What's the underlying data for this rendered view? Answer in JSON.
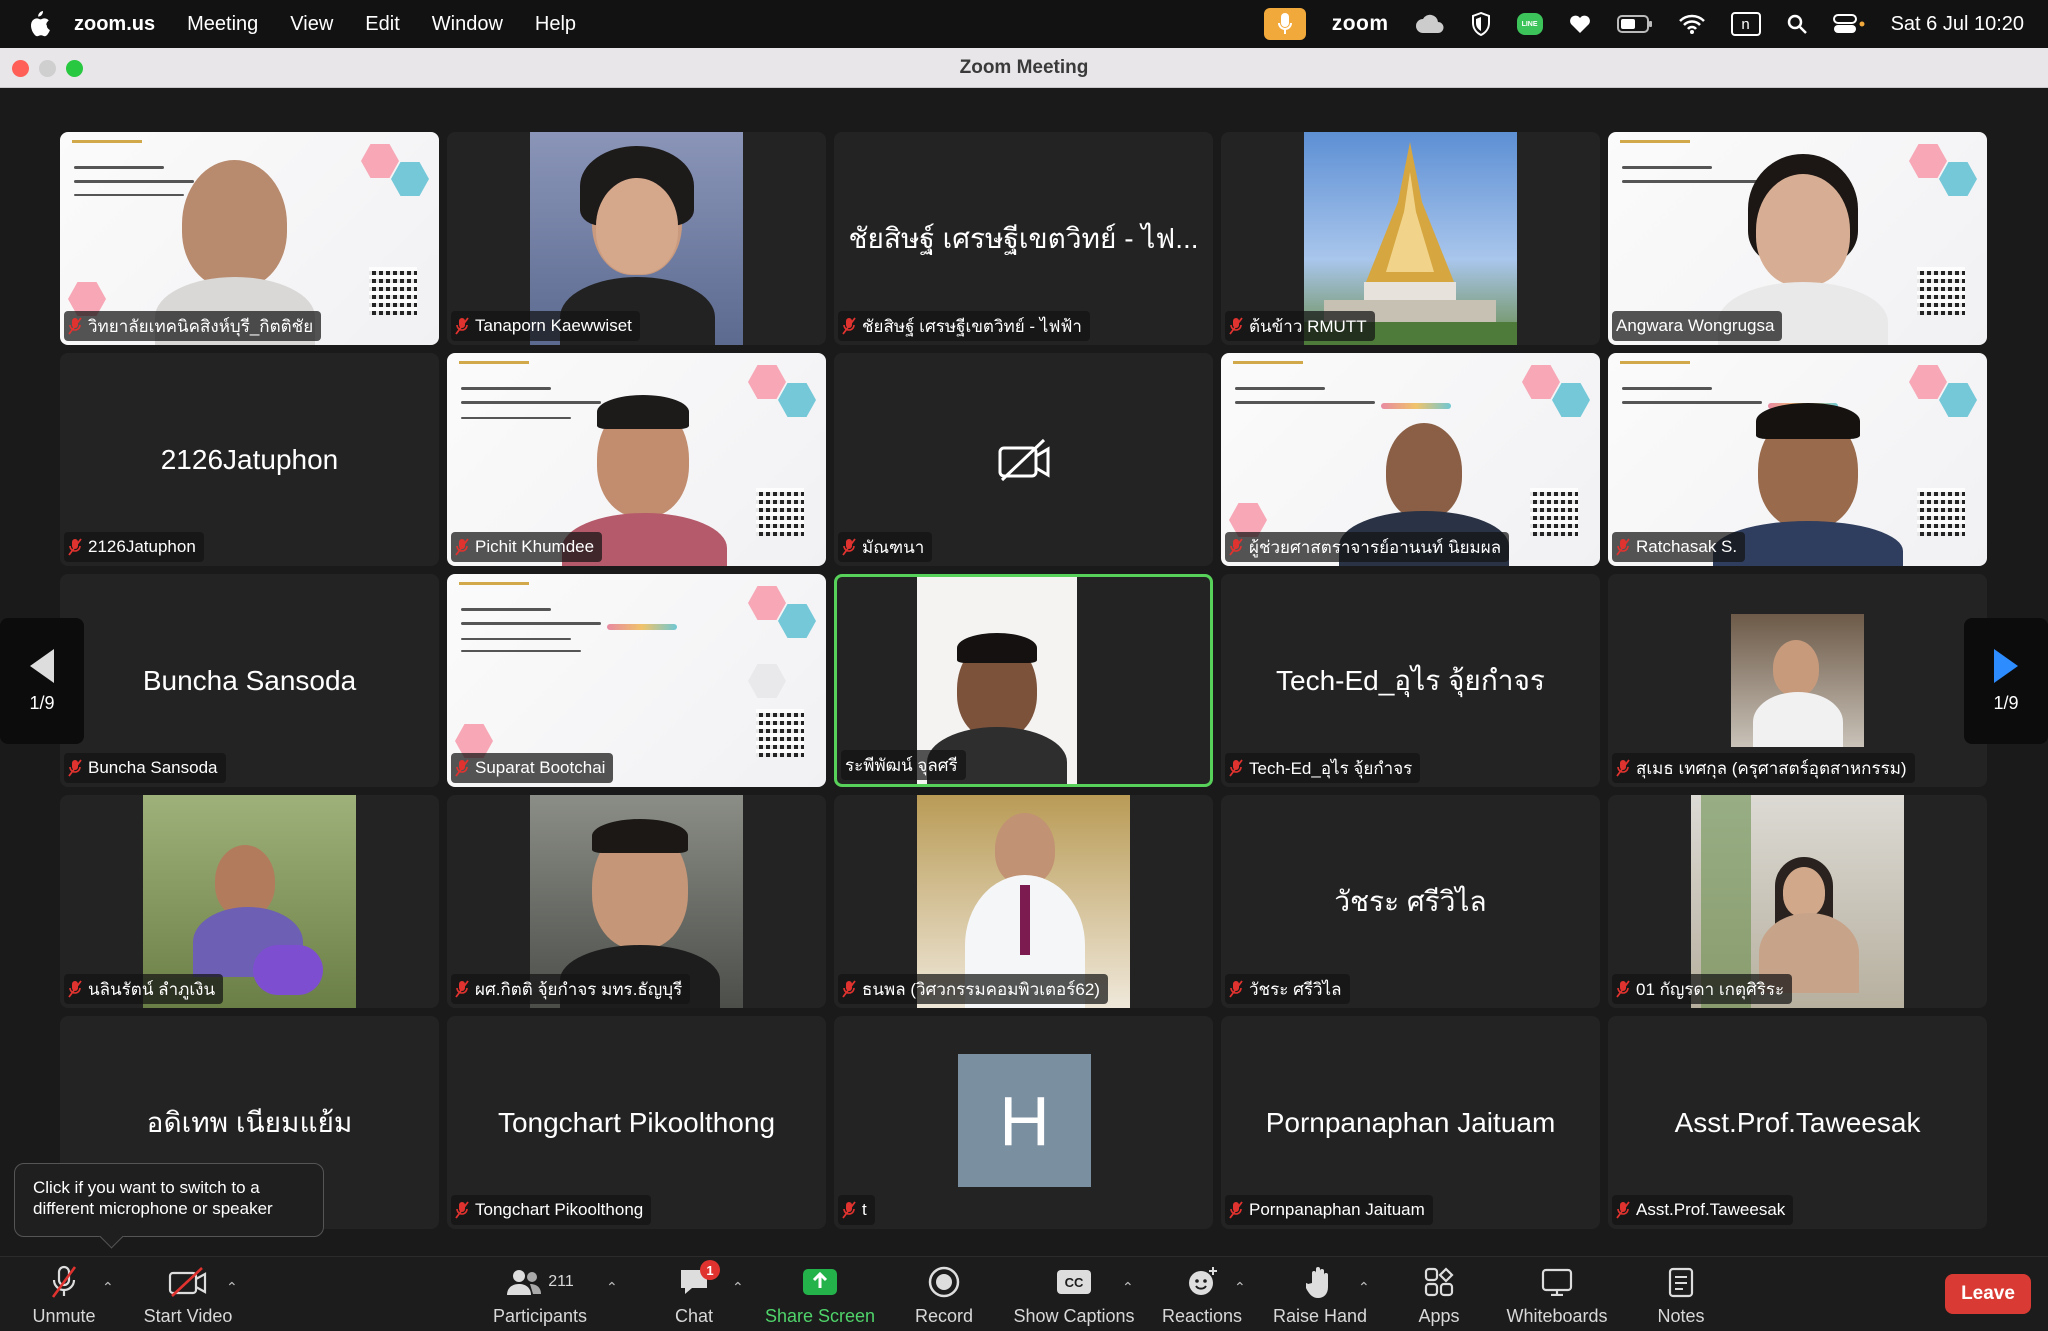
{
  "menubar": {
    "app_name": "zoom.us",
    "items": [
      "Meeting",
      "View",
      "Edit",
      "Window",
      "Help"
    ],
    "zoom_word": "zoom",
    "line_label": "LINE",
    "n_label": "n",
    "clock": "Sat 6 Jul  10:20"
  },
  "window": {
    "title": "Zoom Meeting"
  },
  "pager": {
    "left": "1/9",
    "right": "1/9"
  },
  "tiles": [
    {
      "label": "วิทยาลัยเทคนิคสิงห์บุรี_กิตติชัย",
      "big_name": ""
    },
    {
      "label": "Tanaporn Kaewwiset",
      "big_name": ""
    },
    {
      "label": "ชัยสิษฐ์ เศรษฐีเขตวิทย์ - ไฟฟ้า",
      "big_name": "ชัยสิษฐ์ เศรษฐีเขตวิทย์ - ไฟ..."
    },
    {
      "label": "ต้นข้าว RMUTT",
      "big_name": ""
    },
    {
      "label": "Angwara Wongrugsa",
      "big_name": ""
    },
    {
      "label": "2126Jatuphon",
      "big_name": "2126Jatuphon"
    },
    {
      "label": "Pichit Khumdee",
      "big_name": ""
    },
    {
      "label": "มัณฑนา",
      "big_name": ""
    },
    {
      "label": "ผู้ช่วยศาสตราจารย์อานนท์ นิยมผล",
      "big_name": ""
    },
    {
      "label": "Ratchasak S.",
      "big_name": ""
    },
    {
      "label": "Buncha Sansoda",
      "big_name": "Buncha Sansoda"
    },
    {
      "label": "Suparat Bootchai",
      "big_name": ""
    },
    {
      "label": "ระพีพัฒน์ จุลศรี",
      "big_name": ""
    },
    {
      "label": "Tech-Ed_อุไร จุ้ยกำจร",
      "big_name": "Tech-Ed_อุไร จุ้ยกำจร"
    },
    {
      "label": "สุเมธ เทศกุล (ครุศาสตร์อุตสาหกรรม)",
      "big_name": ""
    },
    {
      "label": "นลินรัตน์ ลำภูเงิน",
      "big_name": ""
    },
    {
      "label": "ผศ.กิตติ จุ้ยกำจร มทร.ธัญบุรี",
      "big_name": ""
    },
    {
      "label": "ธนพล (วิศวกรรมคอมพิวเตอร์62)",
      "big_name": ""
    },
    {
      "label": "วัชระ ศรีวิไล",
      "big_name": "วัชระ ศรีวิไล"
    },
    {
      "label": "01 กัญรดา เกตุศิริระ",
      "big_name": ""
    },
    {
      "label": "",
      "big_name": "อดิเทพ เนียมแย้ม"
    },
    {
      "label": "Tongchart Pikoolthong",
      "big_name": "Tongchart Pikoolthong"
    },
    {
      "label": "t",
      "big_name": ""
    },
    {
      "label": "Pornpanaphan Jaituam",
      "big_name": "Pornpanaphan Jaituam"
    },
    {
      "label": "Asst.Prof.Taweesak",
      "big_name": "Asst.Prof.Taweesak"
    }
  ],
  "avatar_letter": "H",
  "slide_text": {
    "brand": "TECHNICAL EDUCATION",
    "heading1": "โครงการสัมมนา",
    "heading2": "ระหว่างฝึกประสบการณ์",
    "accent": "วิชาชีพครู",
    "line3": "ประจำภาคการศึกษาที่ 1/2567",
    "line4": "วันเสาร์ที่ 6 กรกฎาคม พ.ศ. 2567"
  },
  "tooltip": "Click if you want to switch to a different microphone or speaker",
  "toolbar": {
    "unmute": "Unmute",
    "start_video": "Start Video",
    "participants": "Participants",
    "participants_count": "211",
    "chat": "Chat",
    "chat_badge": "1",
    "share_screen": "Share Screen",
    "record": "Record",
    "show_captions": "Show Captions",
    "cc": "CC",
    "reactions": "Reactions",
    "raise_hand": "Raise Hand",
    "apps": "Apps",
    "whiteboards": "Whiteboards",
    "notes": "Notes",
    "leave": "Leave"
  },
  "colors": {
    "accent_green": "#58d15a",
    "share_green": "#24b24b",
    "leave_red": "#d93a33",
    "nav_blue": "#2d8cff",
    "mute_red": "#e0332f"
  }
}
